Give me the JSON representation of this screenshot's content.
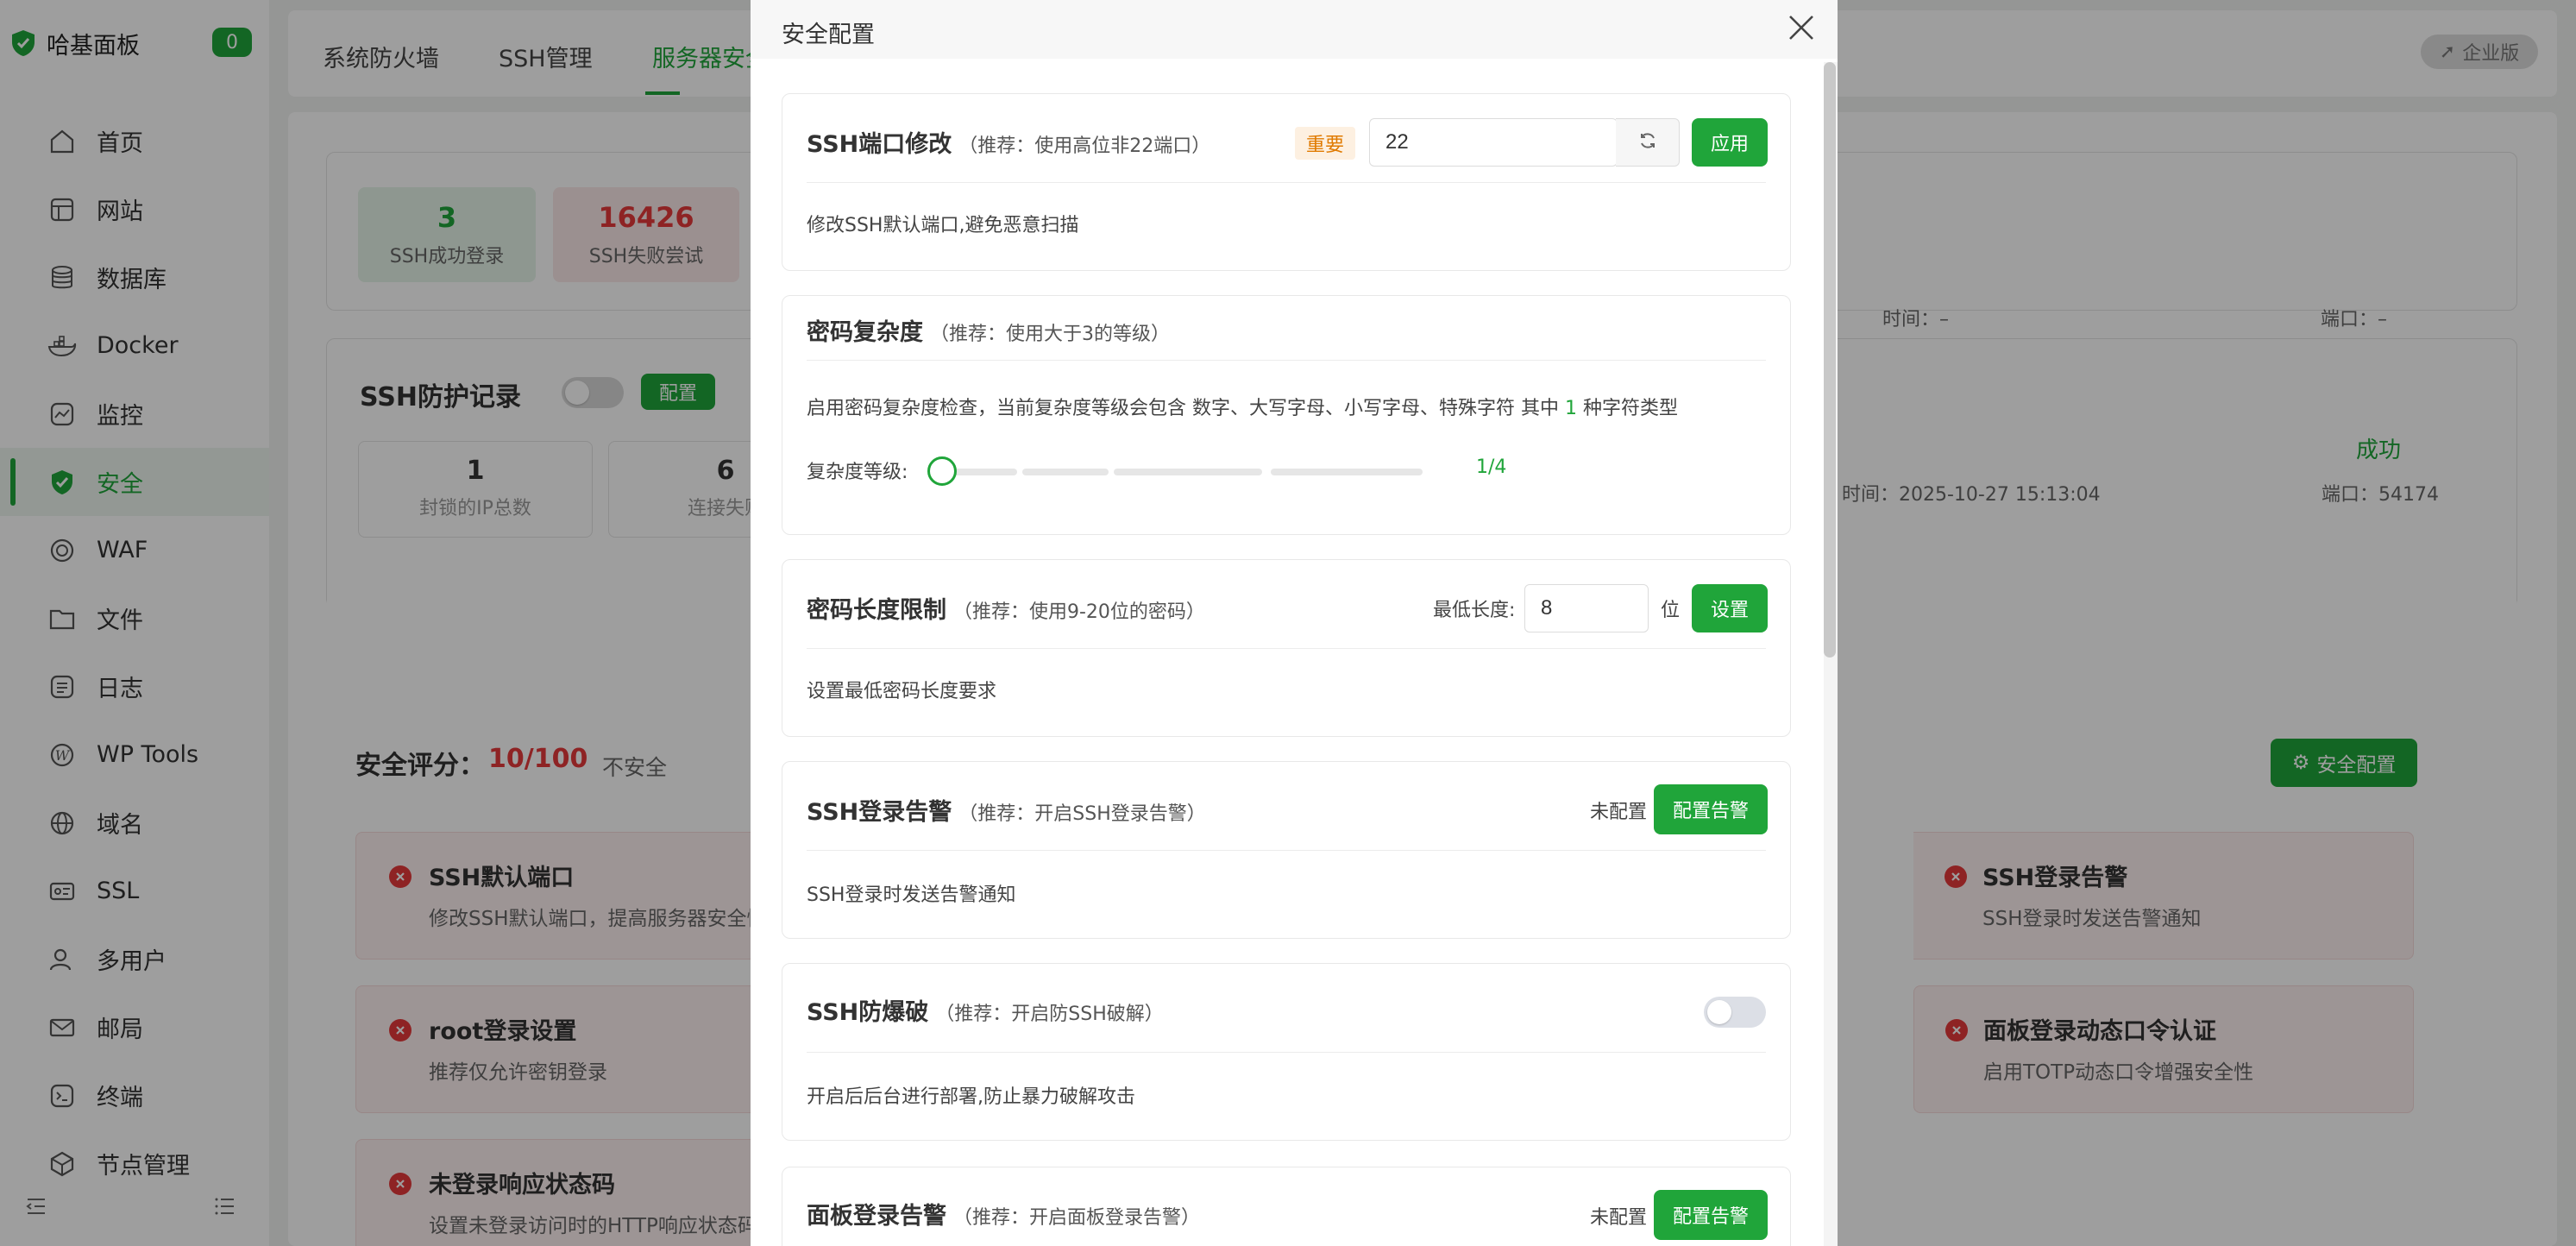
{
  "sidebar": {
    "brand": "哈基面板",
    "badge": "0",
    "items": [
      {
        "label": "首页",
        "icon": "home-icon"
      },
      {
        "label": "网站",
        "icon": "website-icon"
      },
      {
        "label": "数据库",
        "icon": "database-icon"
      },
      {
        "label": "Docker",
        "icon": "docker-icon"
      },
      {
        "label": "监控",
        "icon": "monitor-icon"
      },
      {
        "label": "安全",
        "icon": "shield-icon",
        "active": true
      },
      {
        "label": "WAF",
        "icon": "waf-icon"
      },
      {
        "label": "文件",
        "icon": "folder-icon"
      },
      {
        "label": "日志",
        "icon": "log-icon"
      },
      {
        "label": "WP Tools",
        "icon": "wordpress-icon"
      },
      {
        "label": "域名",
        "icon": "globe-icon"
      },
      {
        "label": "SSL",
        "icon": "ssl-icon"
      },
      {
        "label": "多用户",
        "icon": "user-icon"
      },
      {
        "label": "邮局",
        "icon": "mail-icon"
      },
      {
        "label": "终端",
        "icon": "terminal-icon"
      },
      {
        "label": "节点管理",
        "icon": "node-icon"
      }
    ]
  },
  "topbar": {
    "tabs": [
      "系统防火墙",
      "SSH管理",
      "服务器安全"
    ],
    "active_tab": 2,
    "edition": "企业版"
  },
  "background": {
    "stats": [
      {
        "value": "3",
        "label": "SSH成功登录"
      },
      {
        "value": "16426",
        "label": "SSH失败尝试"
      }
    ],
    "info_right": {
      "time_label": "时间：–",
      "port_label": "端口：–",
      "status": "成功",
      "time2": "时间：2025-10-27 15:13:04",
      "port2": "端口：54174"
    },
    "ssh_protect": {
      "title": "SSH防护记录",
      "config_btn": "配置",
      "stats": [
        {
          "value": "1",
          "label": "封锁的IP总数"
        },
        {
          "value": "6",
          "label": "连接失败"
        }
      ]
    },
    "score": {
      "label": "安全评分：",
      "value": "10/100",
      "status": "不安全",
      "config_btn": "安全配置"
    },
    "cards": [
      {
        "title": "SSH默认端口",
        "desc": "修改SSH默认端口，提高服务器安全性"
      },
      {
        "title": "root登录设置",
        "desc": "推荐仅允许密钥登录"
      },
      {
        "title": "未登录响应状态码",
        "desc": "设置未登录访问时的HTTP响应状态码"
      },
      {
        "title": "SSH登录告警",
        "desc": "SSH登录时发送告警通知"
      },
      {
        "title": "面板登录动态口令认证",
        "desc": "启用TOTP动态口令增强安全性"
      }
    ]
  },
  "modal": {
    "title": "安全配置",
    "sections": {
      "ssh_port": {
        "title": "SSH端口修改",
        "rec": "（推荐：使用高位非22端口）",
        "tag": "重要",
        "value": "22",
        "apply": "应用",
        "desc": "修改SSH默认端口,避免恶意扫描"
      },
      "pwd_complex": {
        "title": "密码复杂度",
        "rec": "（推荐：使用大于3的等级）",
        "desc_pre": "启用密码复杂度检查，当前复杂度等级会包含 数字、大写字母、小写字母、特殊字符 其中",
        "desc_num": "1",
        "desc_post": "种字符类型",
        "level_label": "复杂度等级:",
        "level_text": "1/4",
        "level_value": 1,
        "level_max": 4
      },
      "pwd_length": {
        "title": "密码长度限制",
        "rec": "（推荐：使用9-20位的密码）",
        "min_label": "最低长度:",
        "value": "8",
        "unit": "位",
        "btn": "设置",
        "desc": "设置最低密码长度要求"
      },
      "ssh_alert": {
        "title": "SSH登录告警",
        "rec": "（推荐：开启SSH登录告警）",
        "status": "未配置",
        "btn": "配置告警",
        "desc": "SSH登录时发送告警通知"
      },
      "ssh_brute": {
        "title": "SSH防爆破",
        "rec": "（推荐：开启防SSH破解）",
        "enabled": false,
        "desc": "开启后后台进行部署,防止暴力破解攻击"
      },
      "panel_alert": {
        "title": "面板登录告警",
        "rec": "（推荐：开启面板登录告警）",
        "status": "未配置",
        "btn": "配置告警"
      }
    }
  },
  "colors": {
    "accent": "#20a53a",
    "danger": "#e5393a",
    "important": "#e07a00"
  }
}
